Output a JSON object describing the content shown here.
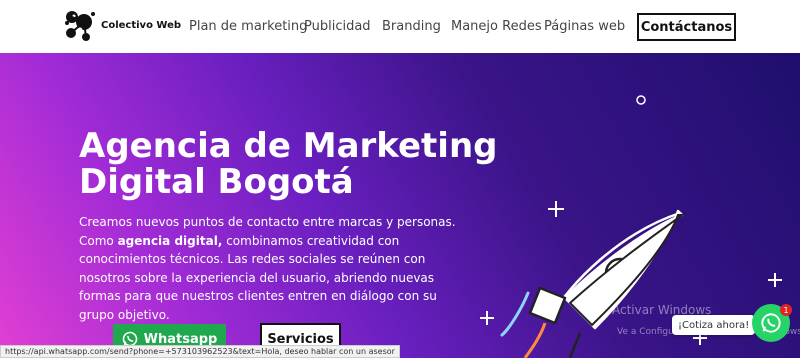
{
  "header": {
    "logo_text": "Colectivo Web",
    "nav": [
      {
        "label": "Plan de marketing"
      },
      {
        "label": "Publicidad"
      },
      {
        "label": "Branding"
      },
      {
        "label": "Manejo Redes"
      },
      {
        "label": "Páginas web"
      }
    ],
    "contact_label": "Contáctanos"
  },
  "hero": {
    "title_line1": "Agencia de Marketing",
    "title_line2": "Digital Bogotá",
    "desc_line1": "Creamos nuevos puntos de contacto entre marcas y personas.",
    "desc_pre": "Como ",
    "desc_bold": "agencia digital,",
    "desc_post": " combinamos creatividad con conocimientos técnicos. Las redes sociales se reúnen con nosotros sobre la experiencia del usuario, abriendo nuevas formas para que nuestros clientes entren en diálogo con su grupo objetivo.",
    "whatsapp_label": "Whatsapp",
    "servicios_label": "Servicios"
  },
  "overlay": {
    "watermark": "Activar Windows",
    "watermark_sub": "Ve a Configuración para activar Windows.",
    "chat_bubble": "¡Cotiza ahora!",
    "chat_badge": "1",
    "status_url": "https://api.whatsapp.com/send?phone=+573103962523&text=Hola, deseo hablar con un asesor"
  },
  "colors": {
    "whatsapp_green": "#1fa84e",
    "gradient_pink": "#e23fd3",
    "gradient_navy": "#1f0e6e"
  },
  "icons": [
    "logo-molecule-icon",
    "whatsapp-icon",
    "rocket-illustration",
    "sparkle-icon",
    "ring-icon"
  ]
}
